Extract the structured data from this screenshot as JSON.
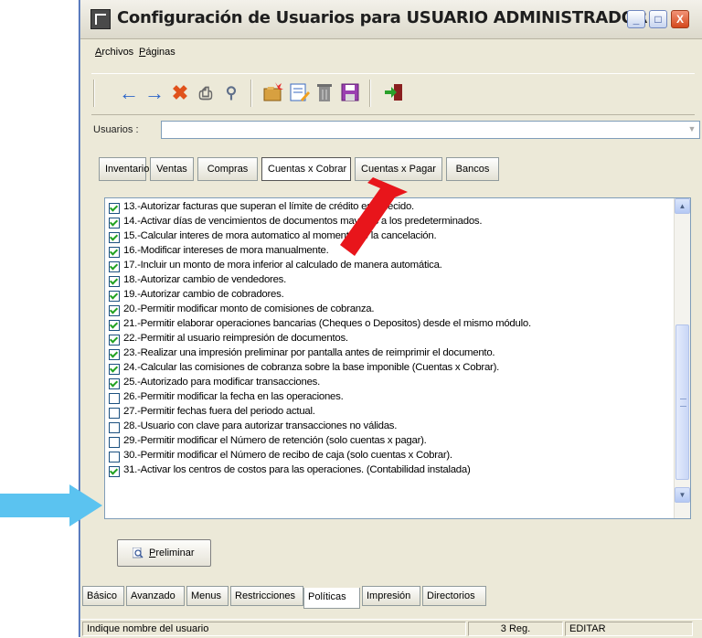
{
  "window": {
    "title": "Configuración de Usuarios para USUARIO ADMINISTRADOR",
    "controls": {
      "minimize": "_",
      "maximize": "□",
      "close": "X"
    }
  },
  "menu": {
    "items": [
      {
        "prefix": "",
        "underlined": "A",
        "rest": "rchivos"
      },
      {
        "prefix": "",
        "underlined": "P",
        "rest": "áginas"
      }
    ]
  },
  "toolbar": {
    "icons": [
      "back-arrow-icon",
      "forward-arrow-icon",
      "cancel-x-icon",
      "print-icon",
      "search-icon",
      "new-folder-icon",
      "edit-icon",
      "delete-icon",
      "save-icon",
      "exit-icon"
    ]
  },
  "users": {
    "label": "Usuarios :",
    "value": ""
  },
  "top_tabs": [
    {
      "label": "Inventario",
      "active": false
    },
    {
      "label": "Ventas",
      "active": false
    },
    {
      "label": "Compras",
      "active": false
    },
    {
      "label": "Cuentas x Cobrar",
      "active": true
    },
    {
      "label": "Cuentas x Pagar",
      "active": false
    },
    {
      "label": "Bancos",
      "active": false
    }
  ],
  "permissions": [
    {
      "text": "13.-Autorizar facturas que superan el límite de crédito establecido.",
      "checked": true
    },
    {
      "text": "14.-Activar días de vencimientos de documentos mayores a los predeterminados.",
      "checked": true
    },
    {
      "text": "15.-Calcular interes de mora automatico al momento de la cancelación.",
      "checked": true
    },
    {
      "text": "16.-Modificar intereses de mora manualmente.",
      "checked": true
    },
    {
      "text": "17.-Incluir un monto de mora inferior al calculado de manera automática.",
      "checked": true
    },
    {
      "text": "18.-Autorizar cambio de vendedores.",
      "checked": true
    },
    {
      "text": "19.-Autorizar cambio de cobradores.",
      "checked": true
    },
    {
      "text": "20.-Permitir modificar monto de comisiones de cobranza.",
      "checked": true
    },
    {
      "text": "21.-Permitir elaborar operaciones bancarias (Cheques o Depositos) desde el mismo módulo.",
      "checked": true
    },
    {
      "text": "22.-Permitir al usuario reimpresión de documentos.",
      "checked": true
    },
    {
      "text": "23.-Realizar una impresión preliminar por pantalla antes de reimprimir el documento.",
      "checked": true
    },
    {
      "text": "24.-Calcular las comisiones de cobranza sobre la base imponible (Cuentas x Cobrar).",
      "checked": true
    },
    {
      "text": "25.-Autorizado para modificar transacciones.",
      "checked": true
    },
    {
      "text": "26.-Permitir modificar la fecha en las operaciones.",
      "checked": false
    },
    {
      "text": "27.-Permitir fechas fuera del periodo actual.",
      "checked": false
    },
    {
      "text": "28.-Usuario con clave para autorizar transacciones no válidas.",
      "checked": false
    },
    {
      "text": "29.-Permitir modificar el Número de retención (solo cuentas x pagar).",
      "checked": false
    },
    {
      "text": "30.-Permitir modificar el Número de recibo de caja (solo cuentas x Cobrar).",
      "checked": false
    },
    {
      "text": "31.-Activar los centros de costos para las operaciones. (Contabilidad instalada)",
      "checked": true
    }
  ],
  "preview_button": {
    "underlined": "P",
    "rest": "reliminar"
  },
  "bottom_tabs": [
    {
      "label": "Básico",
      "active": false
    },
    {
      "label": "Avanzado",
      "active": false
    },
    {
      "label": "Menus",
      "active": false
    },
    {
      "label": "Restricciones",
      "active": false
    },
    {
      "label": "Políticas",
      "active": true
    },
    {
      "label": "Impresión",
      "active": false
    },
    {
      "label": "Directorios",
      "active": false
    }
  ],
  "status": {
    "hint": "Indique nombre del usuario",
    "records": "3 Reg.",
    "mode": "EDITAR"
  },
  "colors": {
    "window_bg": "#ece9d8",
    "arrow_red": "#e8151b",
    "arrow_blue": "#5bc3f0",
    "check_green": "#21a121"
  }
}
